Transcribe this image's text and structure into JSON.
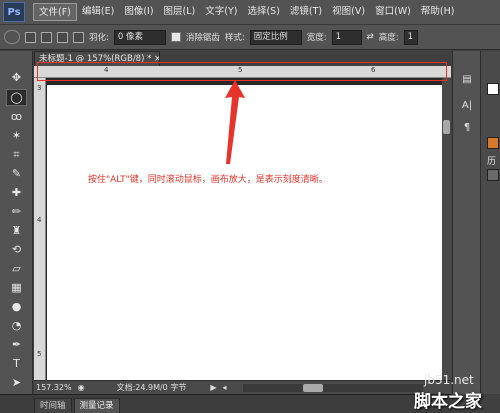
{
  "app": {
    "logo": "Ps",
    "menus": [
      "文件(F)",
      "编辑(E)",
      "图像(I)",
      "图层(L)",
      "文字(Y)",
      "选择(S)",
      "滤镜(T)",
      "视图(V)",
      "窗口(W)",
      "帮助(H)"
    ],
    "window_controls": [
      "—",
      "□",
      "✕"
    ]
  },
  "options_bar": {
    "feather_label": "羽化:",
    "feather_value": "0 像素",
    "antialias_label": "消除锯齿",
    "style_label": "样式:",
    "style_value": "固定比例",
    "width_label": "宽度:",
    "width_value": "1",
    "height_label": "高度:",
    "height_value": "1"
  },
  "document": {
    "tab_title": "未标题-1 @ 157%(RGB/8) *  ×",
    "ruler_h_ticks": [
      "4",
      "5",
      "6"
    ],
    "ruler_v_ticks": [
      "3",
      "4",
      "5"
    ]
  },
  "annotation": {
    "text": "按住\"ALT\"键，同时滚动鼠标，画布放大，是表示刻度清晰。"
  },
  "status": {
    "zoom": "157.32%",
    "doc_info": "文档:24.9M/0 字节"
  },
  "bottom_tabs": [
    "时间轴",
    "测量记录"
  ],
  "right_panel": {
    "label": "历"
  },
  "watermark": {
    "line1": "jb51.net",
    "line2": "脚本之家"
  },
  "colors": {
    "annotation_red": "#e8332a",
    "ui_gray": "#535353"
  }
}
